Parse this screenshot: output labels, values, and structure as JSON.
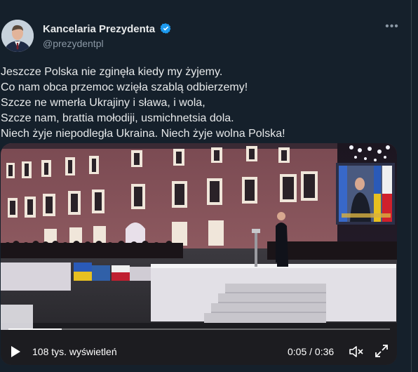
{
  "tweet": {
    "author_name": "Kancelaria Prezydenta",
    "handle": "@prezydentpl",
    "verified": true,
    "more_icon": "more-icon",
    "text_lines": [
      "Jeszcze Polska nie zginęła kiedy my żyjemy.",
      "Co nam obca przemoc wzięła szablą odbierzemy!",
      "Szcze ne wmerła Ukrajiny i sława, i wola,",
      "Szcze nam, brattia mołodiji, usmichnetsia dola.",
      "Niech żyje niepodległa Ukraina. Niech żyje wolna Polska!"
    ]
  },
  "video": {
    "views_label": "108 tys. wyświetleń",
    "time_label": "0:05 / 0:36",
    "progress_fraction": 0.139,
    "icons": [
      "play-icon",
      "volume-mute-icon",
      "fullscreen-icon"
    ]
  },
  "colors": {
    "background": "#15202b",
    "text": "#e7e9ea",
    "secondary": "#8b98a5",
    "verified": "#1d9bf0"
  }
}
